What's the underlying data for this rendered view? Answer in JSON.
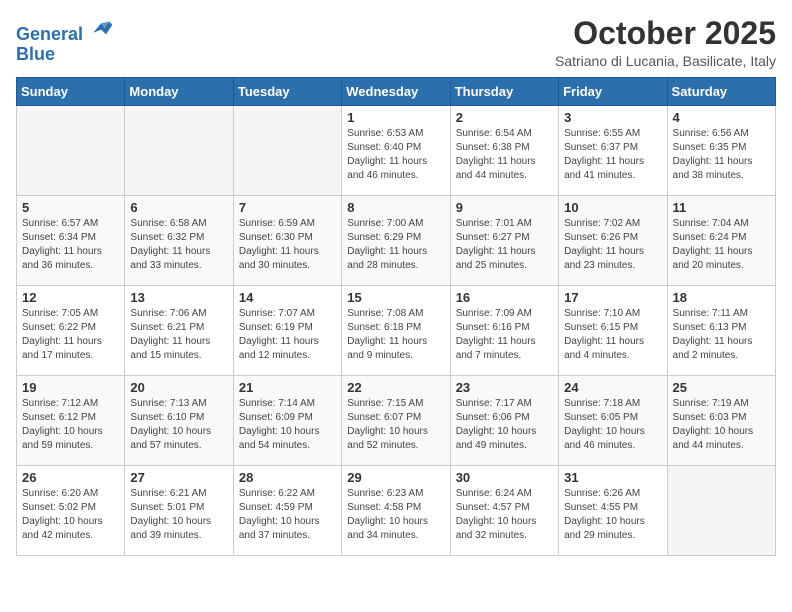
{
  "logo": {
    "line1": "General",
    "line2": "Blue"
  },
  "title": "October 2025",
  "location": "Satriano di Lucania, Basilicate, Italy",
  "weekdays": [
    "Sunday",
    "Monday",
    "Tuesday",
    "Wednesday",
    "Thursday",
    "Friday",
    "Saturday"
  ],
  "weeks": [
    [
      {
        "day": "",
        "info": ""
      },
      {
        "day": "",
        "info": ""
      },
      {
        "day": "",
        "info": ""
      },
      {
        "day": "1",
        "info": "Sunrise: 6:53 AM\nSunset: 6:40 PM\nDaylight: 11 hours\nand 46 minutes."
      },
      {
        "day": "2",
        "info": "Sunrise: 6:54 AM\nSunset: 6:38 PM\nDaylight: 11 hours\nand 44 minutes."
      },
      {
        "day": "3",
        "info": "Sunrise: 6:55 AM\nSunset: 6:37 PM\nDaylight: 11 hours\nand 41 minutes."
      },
      {
        "day": "4",
        "info": "Sunrise: 6:56 AM\nSunset: 6:35 PM\nDaylight: 11 hours\nand 38 minutes."
      }
    ],
    [
      {
        "day": "5",
        "info": "Sunrise: 6:57 AM\nSunset: 6:34 PM\nDaylight: 11 hours\nand 36 minutes."
      },
      {
        "day": "6",
        "info": "Sunrise: 6:58 AM\nSunset: 6:32 PM\nDaylight: 11 hours\nand 33 minutes."
      },
      {
        "day": "7",
        "info": "Sunrise: 6:59 AM\nSunset: 6:30 PM\nDaylight: 11 hours\nand 30 minutes."
      },
      {
        "day": "8",
        "info": "Sunrise: 7:00 AM\nSunset: 6:29 PM\nDaylight: 11 hours\nand 28 minutes."
      },
      {
        "day": "9",
        "info": "Sunrise: 7:01 AM\nSunset: 6:27 PM\nDaylight: 11 hours\nand 25 minutes."
      },
      {
        "day": "10",
        "info": "Sunrise: 7:02 AM\nSunset: 6:26 PM\nDaylight: 11 hours\nand 23 minutes."
      },
      {
        "day": "11",
        "info": "Sunrise: 7:04 AM\nSunset: 6:24 PM\nDaylight: 11 hours\nand 20 minutes."
      }
    ],
    [
      {
        "day": "12",
        "info": "Sunrise: 7:05 AM\nSunset: 6:22 PM\nDaylight: 11 hours\nand 17 minutes."
      },
      {
        "day": "13",
        "info": "Sunrise: 7:06 AM\nSunset: 6:21 PM\nDaylight: 11 hours\nand 15 minutes."
      },
      {
        "day": "14",
        "info": "Sunrise: 7:07 AM\nSunset: 6:19 PM\nDaylight: 11 hours\nand 12 minutes."
      },
      {
        "day": "15",
        "info": "Sunrise: 7:08 AM\nSunset: 6:18 PM\nDaylight: 11 hours\nand 9 minutes."
      },
      {
        "day": "16",
        "info": "Sunrise: 7:09 AM\nSunset: 6:16 PM\nDaylight: 11 hours\nand 7 minutes."
      },
      {
        "day": "17",
        "info": "Sunrise: 7:10 AM\nSunset: 6:15 PM\nDaylight: 11 hours\nand 4 minutes."
      },
      {
        "day": "18",
        "info": "Sunrise: 7:11 AM\nSunset: 6:13 PM\nDaylight: 11 hours\nand 2 minutes."
      }
    ],
    [
      {
        "day": "19",
        "info": "Sunrise: 7:12 AM\nSunset: 6:12 PM\nDaylight: 10 hours\nand 59 minutes."
      },
      {
        "day": "20",
        "info": "Sunrise: 7:13 AM\nSunset: 6:10 PM\nDaylight: 10 hours\nand 57 minutes."
      },
      {
        "day": "21",
        "info": "Sunrise: 7:14 AM\nSunset: 6:09 PM\nDaylight: 10 hours\nand 54 minutes."
      },
      {
        "day": "22",
        "info": "Sunrise: 7:15 AM\nSunset: 6:07 PM\nDaylight: 10 hours\nand 52 minutes."
      },
      {
        "day": "23",
        "info": "Sunrise: 7:17 AM\nSunset: 6:06 PM\nDaylight: 10 hours\nand 49 minutes."
      },
      {
        "day": "24",
        "info": "Sunrise: 7:18 AM\nSunset: 6:05 PM\nDaylight: 10 hours\nand 46 minutes."
      },
      {
        "day": "25",
        "info": "Sunrise: 7:19 AM\nSunset: 6:03 PM\nDaylight: 10 hours\nand 44 minutes."
      }
    ],
    [
      {
        "day": "26",
        "info": "Sunrise: 6:20 AM\nSunset: 5:02 PM\nDaylight: 10 hours\nand 42 minutes."
      },
      {
        "day": "27",
        "info": "Sunrise: 6:21 AM\nSunset: 5:01 PM\nDaylight: 10 hours\nand 39 minutes."
      },
      {
        "day": "28",
        "info": "Sunrise: 6:22 AM\nSunset: 4:59 PM\nDaylight: 10 hours\nand 37 minutes."
      },
      {
        "day": "29",
        "info": "Sunrise: 6:23 AM\nSunset: 4:58 PM\nDaylight: 10 hours\nand 34 minutes."
      },
      {
        "day": "30",
        "info": "Sunrise: 6:24 AM\nSunset: 4:57 PM\nDaylight: 10 hours\nand 32 minutes."
      },
      {
        "day": "31",
        "info": "Sunrise: 6:26 AM\nSunset: 4:55 PM\nDaylight: 10 hours\nand 29 minutes."
      },
      {
        "day": "",
        "info": ""
      }
    ]
  ]
}
